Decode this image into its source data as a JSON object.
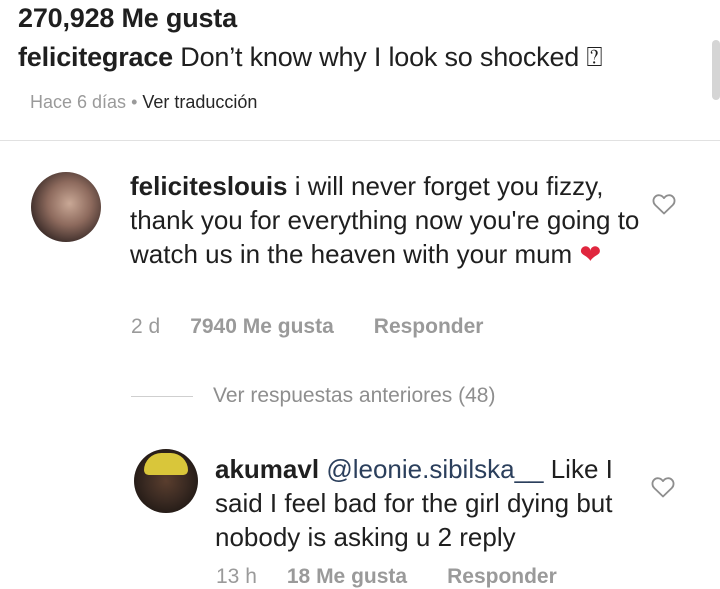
{
  "post": {
    "likes_text": "270,928 Me gusta",
    "caption_user": "felicitegrace",
    "caption_text": " Don’t know why I look so shocked ⍰",
    "time_ago": "Hace 6 días",
    "separator": " • ",
    "translate_label": "Ver traducción"
  },
  "comments": [
    {
      "user": "feliciteslouis",
      "text": " i will never forget you fizzy, thank you for everything now you're going to watch us in the heaven with your mum ",
      "emoji": "❤",
      "time": "2 d",
      "likes": "7940 Me gusta",
      "reply_label": "Responder"
    },
    {
      "user": "akumavl",
      "mention": "@leonie.sibilska__",
      "text": " Like I said I feel bad for the girl dying but nobody is asking u 2 reply",
      "time": "13 h",
      "likes": "18 Me gusta",
      "reply_label": "Responder"
    }
  ],
  "view_previous_replies": "Ver respuestas anteriores (48)",
  "icons": {
    "like": "heart-outline-icon",
    "avatar1": "avatar",
    "avatar2": "avatar"
  },
  "colors": {
    "text": "#262626",
    "muted": "#9a9a9a",
    "heart": "#e0263e"
  }
}
